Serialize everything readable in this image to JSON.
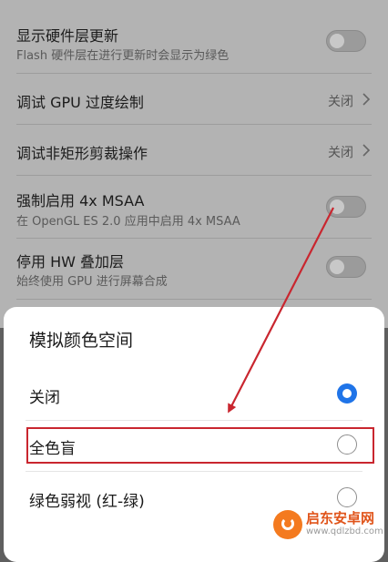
{
  "settings": {
    "rows": [
      {
        "title": "显示硬件层更新",
        "sub": "Flash 硬件层在进行更新时会显示为绿色",
        "toggle": false
      },
      {
        "title": "调试 GPU 过度绘制",
        "value": "关闭"
      },
      {
        "title": "调试非矩形剪裁操作",
        "value": "关闭"
      },
      {
        "title": "强制启用 4x MSAA",
        "sub": "在 OpenGL ES 2.0 应用中启用 4x MSAA",
        "toggle": false
      },
      {
        "title": "停用 HW 叠加层",
        "sub": "始终使用 GPU 进行屏幕合成",
        "toggle": false
      }
    ]
  },
  "dialog": {
    "title": "模拟颜色空间",
    "options": [
      {
        "label": "关闭",
        "selected": true
      },
      {
        "label": "全色盲",
        "selected": false
      },
      {
        "label": "绿色弱视 (红-绿)",
        "selected": false
      }
    ]
  },
  "annotation": {
    "color": "#c9262f"
  },
  "watermark": {
    "name": "启东安卓网",
    "url": "www.qdlzbd.com"
  }
}
